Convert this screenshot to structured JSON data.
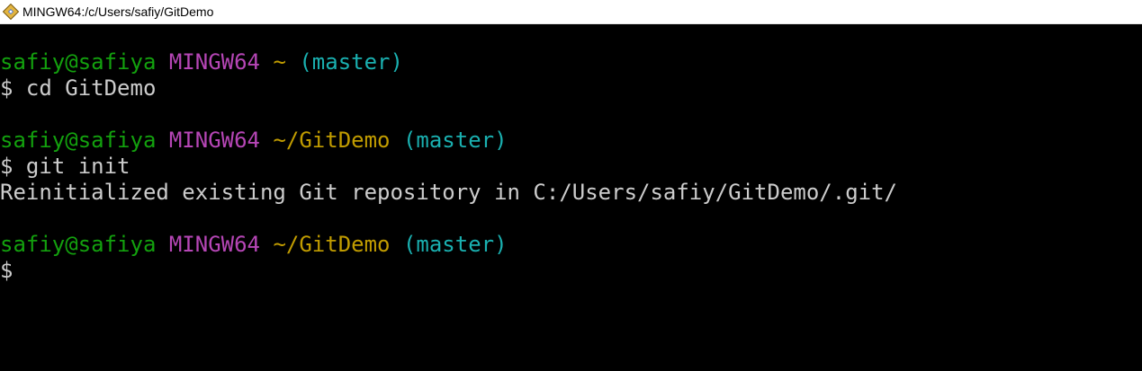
{
  "window": {
    "title": "MINGW64:/c/Users/safiy/GitDemo",
    "icon": "mingw-git-icon"
  },
  "colors": {
    "background": "#000000",
    "user_host": "#13a10e",
    "env": "#b646b6",
    "path": "#c19c00",
    "branch": "#1ab0b0",
    "text": "#cccccc"
  },
  "terminal": {
    "block1": {
      "user_host": "safiy@safiya",
      "env": "MINGW64",
      "path": "~",
      "branch": "(master)",
      "prompt_symbol": "$",
      "command": "cd GitDemo"
    },
    "block2": {
      "user_host": "safiy@safiya",
      "env": "MINGW64",
      "path": "~/GitDemo",
      "branch": "(master)",
      "prompt_symbol": "$",
      "command": "git init",
      "output": "Reinitialized existing Git repository in C:/Users/safiy/GitDemo/.git/"
    },
    "block3": {
      "user_host": "safiy@safiya",
      "env": "MINGW64",
      "path": "~/GitDemo",
      "branch": "(master)",
      "prompt_symbol": "$"
    }
  }
}
